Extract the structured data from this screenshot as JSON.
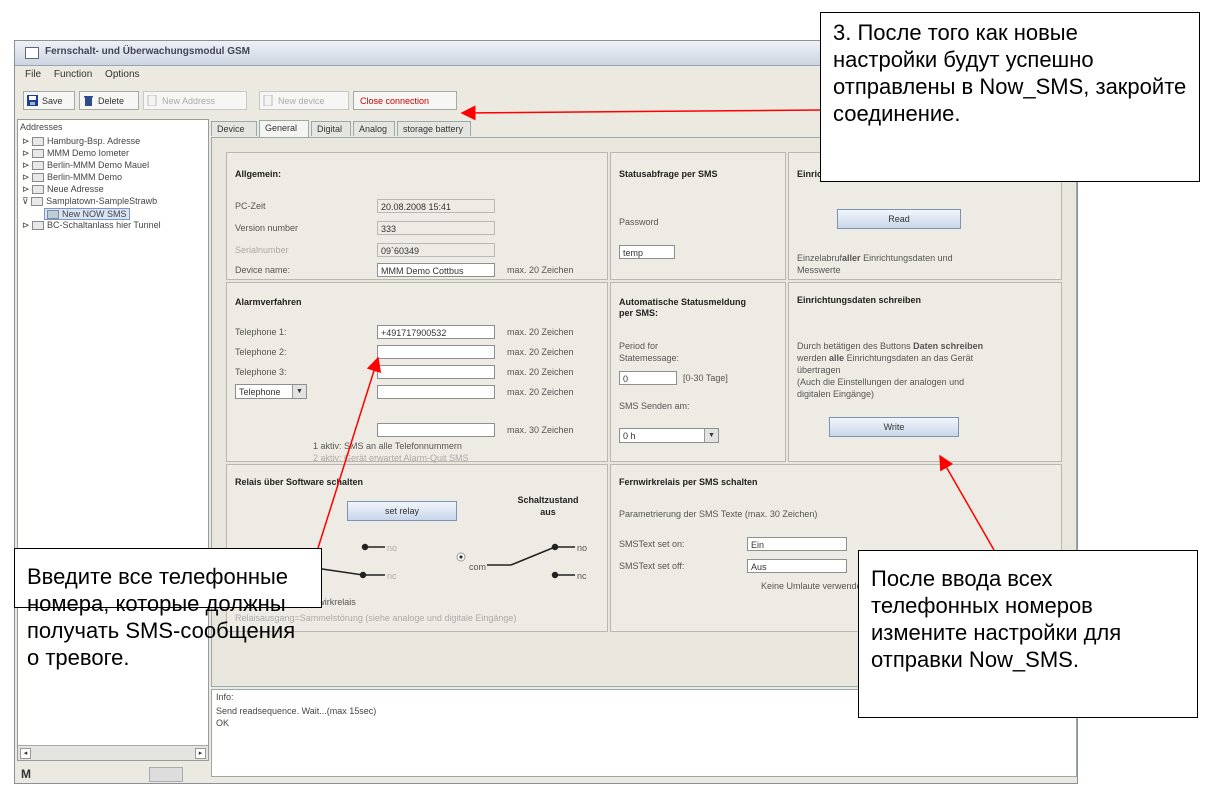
{
  "window": {
    "title": "Fernschalt- und Überwachungsmodul GSM"
  },
  "menu": [
    "File",
    "Function",
    "Options"
  ],
  "toolbar": {
    "save": "Save",
    "delete": "Delete",
    "new_address": "New Address",
    "new_device": "New device",
    "close_connection": "Close connection"
  },
  "tree": {
    "root": "Addresses",
    "items": [
      "Hamburg-Bsp. Adresse",
      "MMM Demo Iometer",
      "Berlin-MMM Demo Mauel",
      "Berlin-MMM Demo",
      "Neue Adresse",
      "Samplatown-SampleStrawb",
      "New NOW SMS",
      "BC-Schaltanlass hier Tunnel"
    ]
  },
  "tabs": [
    "Device",
    "General",
    "Digital",
    "Analog",
    "storage battery"
  ],
  "allgemein": {
    "header": "Allgemein:",
    "pc_time_label": "PC-Zeit",
    "pc_time_value": "20.08.2008 15:41",
    "version_label": "Version number",
    "version_value": "333",
    "serial_label": "Serialnumber",
    "serial_value": "09`60349",
    "device_name_label": "Device name:",
    "device_name_value": "MMM Demo Cottbus",
    "device_name_hint": "max. 20 Zeichen"
  },
  "status_sms": {
    "header": "Statusabfrage per SMS",
    "password_label": "Password",
    "password_value": "temp"
  },
  "read_panel": {
    "header": "Einrichtungsdaten lesen",
    "button": "Read",
    "desc_1": "Einzelabruf",
    "desc_bold": "aller",
    "desc_2": "Einrichtungsdaten und",
    "desc_3": "Messwerte"
  },
  "alarm": {
    "header": "Alarmverfahren",
    "tel1_label": "Telephone 1:",
    "tel1_value": "+491717900532",
    "tel2_label": "Telephone 2:",
    "tel3_label": "Telephone 3:",
    "combo_value": "Telephone",
    "hint": "max. 20 Zeichen",
    "hint30": "max. 30 Zeichen",
    "opt1": "1 aktiv: SMS an alle Telefonnummern",
    "opt2": "2 aktiv: Gerät erwartet Alarm-Quit SMS"
  },
  "auto_status": {
    "header_1": "Automatische Statusmeldung",
    "header_2": "per SMS:",
    "period_1": "Period for",
    "period_2": "Statemessage:",
    "period_value": "0",
    "period_range": "[0-30 Tage]",
    "sms_send_label": "SMS Senden am:",
    "sms_send_value": "0 h"
  },
  "write_panel": {
    "header": "Einrichtungsdaten schreiben",
    "desc_1a": "Durch betätigen des Buttons",
    "desc_1b": "Daten schreiben",
    "desc_2a": "werden",
    "desc_2b": "alle",
    "desc_2c": "Einrichtungsdaten an das Gerät",
    "desc_3": "übertragen",
    "desc_4": "(Auch die Einstellungen der analogen und",
    "desc_5": "digitalen Eingänge)",
    "button": "Write"
  },
  "relay": {
    "header": "Relais über Software schalten",
    "set_button": "set relay",
    "state_1": "Schaltzustand",
    "state_2": "aus",
    "com": "com",
    "no": "no",
    "nc": "nc",
    "foot1": "Relaisausgang=Fernwirkrelais",
    "foot2": "Relaisausgang=Sammelstörung (siehe analoge und digitale Eingänge)"
  },
  "remote_relay": {
    "header": "Fernwirkrelais per SMS schalten",
    "param": "Parametrierung der SMS Texte (max. 30 Zeichen)",
    "on_label": "SMSText set on:",
    "on_value": "Ein",
    "off_label": "SMSText set off:",
    "off_value": "Aus",
    "note": "Keine Umlaute verwenden"
  },
  "info": {
    "label": "Info:",
    "line1": "Send readsequence. Wait...(max 15sec)",
    "line2": "OK"
  },
  "callouts": {
    "top": "3. После того как новые настройки будут успешно отправлены в Now_SMS, закройте соединение.",
    "left": "Введите все телефонные номера, которые должны получать SMS-сообщения о тревоге.",
    "right": "После ввода всех телефонных номеров измените настройки для отправки Now_SMS."
  },
  "colors": {
    "annotation_arrow": "#ff0000",
    "close_connection_text": "#cc0000"
  }
}
